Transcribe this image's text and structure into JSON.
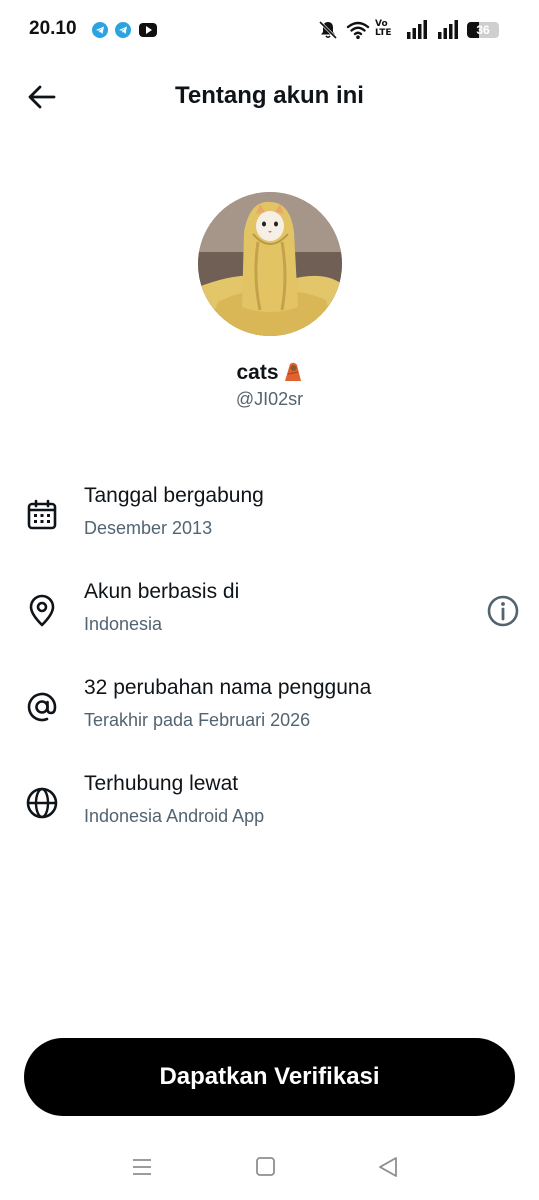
{
  "status_bar": {
    "time": "20.10",
    "notification_icons": [
      "telegram-icon",
      "telegram-icon",
      "youtube-icon"
    ],
    "system_icons": [
      "bell-muted-icon",
      "wifi-icon",
      "volte-icon",
      "signal-icon",
      "signal-icon",
      "battery-icon"
    ],
    "volte_line1": "Vo",
    "volte_line2": "LTE",
    "battery_percent": 36,
    "battery_label": "36"
  },
  "header": {
    "back_icon": "arrow-left-icon",
    "title": "Tentang akun ini"
  },
  "profile": {
    "display_name": "cats",
    "name_emoji": "cat-in-blanket-emoji",
    "handle": "@JI02sr",
    "avatar": "cat-wrapped-in-yellow-blanket-photo"
  },
  "info": {
    "joined": {
      "icon": "calendar-icon",
      "title": "Tanggal bergabung",
      "value": "Desember 2013"
    },
    "based_in": {
      "icon": "location-pin-icon",
      "title": "Akun berbasis di",
      "value": "Indonesia",
      "action_icon": "info-circle-icon"
    },
    "username_changes": {
      "icon": "at-sign-icon",
      "title": "32 perubahan nama pengguna",
      "value": "Terakhir pada Februari 2026"
    },
    "connected_via": {
      "icon": "globe-icon",
      "title": "Terhubung lewat",
      "value": "Indonesia Android App"
    }
  },
  "cta": {
    "label": "Dapatkan Verifikasi"
  },
  "nav_bar": [
    "menu-icon",
    "home-square-icon",
    "back-triangle-icon"
  ],
  "colors": {
    "text_primary": "#0f1419",
    "text_secondary": "#536471",
    "button_bg": "#000000",
    "button_text": "#ffffff"
  }
}
